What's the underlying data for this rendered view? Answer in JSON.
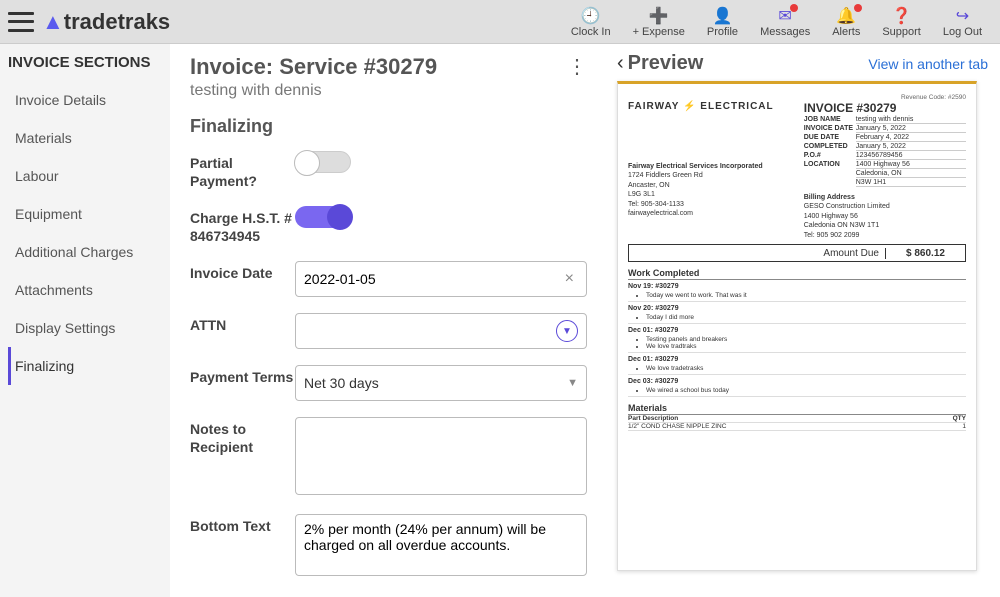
{
  "brand": {
    "name": "tradetraks"
  },
  "top_actions": [
    {
      "label": "Clock In",
      "icon": "🕘",
      "name": "clock-in"
    },
    {
      "label": "+ Expense",
      "icon": "➕",
      "name": "add-expense"
    },
    {
      "label": "Profile",
      "icon": "👤",
      "name": "profile"
    },
    {
      "label": "Messages",
      "icon": "✉",
      "name": "messages",
      "badge": true
    },
    {
      "label": "Alerts",
      "icon": "🔔",
      "name": "alerts",
      "badge": true
    },
    {
      "label": "Support",
      "icon": "❓",
      "name": "support"
    },
    {
      "label": "Log Out",
      "icon": "↪",
      "name": "logout"
    }
  ],
  "sidebar": {
    "heading": "INVOICE SECTIONS",
    "items": [
      "Invoice Details",
      "Materials",
      "Labour",
      "Equipment",
      "Additional Charges",
      "Attachments",
      "Display Settings",
      "Finalizing"
    ],
    "active_index": 7
  },
  "form": {
    "title": "Invoice: Service #30279",
    "subtitle": "testing with dennis",
    "section_heading": "Finalizing",
    "labels": {
      "partial_payment": "Partial Payment?",
      "charge_hst": "Charge H.S.T. # 846734945",
      "invoice_date": "Invoice Date",
      "attn": "ATTN",
      "payment_terms": "Payment Terms",
      "notes": "Notes to Recipient",
      "bottom_text": "Bottom Text"
    },
    "values": {
      "partial_payment": false,
      "charge_hst": true,
      "invoice_date": "2022-01-05",
      "attn": "",
      "payment_terms": "Net 30 days",
      "notes": "",
      "bottom_text": "2% per month (24% per annum) will be charged on all overdue accounts."
    }
  },
  "preview": {
    "title": "Preview",
    "new_tab": "View in another tab"
  },
  "invoice_doc": {
    "revenue_code": "Revenue Code: #2590",
    "company_logo": "FAIRWAY ⚡ ELECTRICAL",
    "heading": "INVOICE #30279",
    "meta": [
      {
        "k": "JOB NAME",
        "v": "testing with dennis"
      },
      {
        "k": "INVOICE DATE",
        "v": "January 5, 2022"
      },
      {
        "k": "DUE DATE",
        "v": "February 4, 2022"
      },
      {
        "k": "COMPLETED",
        "v": "January 5, 2022"
      },
      {
        "k": "P.O.#",
        "v": "123456789456"
      },
      {
        "k": "LOCATION",
        "v": "1400 Highway 56"
      },
      {
        "k": "",
        "v": "Caledonia, ON"
      },
      {
        "k": "",
        "v": "N3W 1H1"
      }
    ],
    "company_addr": [
      "Fairway Electrical Services Incorporated",
      "1724 Fiddlers Green Rd",
      "Ancaster, ON",
      "L9G 3L1",
      "Tel: 905-304-1133",
      "fairwayelectrical.com"
    ],
    "billing": {
      "heading": "Billing Address",
      "lines": [
        "GESO Construction Limited",
        "1400 Highway 56",
        "Caledonia ON N3W 1T1",
        "Tel: 905 902 2099"
      ]
    },
    "amount_due": {
      "label": "Amount Due",
      "value": "$ 860.12"
    },
    "work_completed": {
      "heading": "Work Completed",
      "entries": [
        {
          "date": "Nov 19: #30279",
          "notes": [
            "Today we went to work. That was it"
          ]
        },
        {
          "date": "Nov 20: #30279",
          "notes": [
            "Today I did more"
          ]
        },
        {
          "date": "Dec 01: #30279",
          "notes": [
            "Testing panels and breakers",
            "We love tradtraks"
          ]
        },
        {
          "date": "Dec 01: #30279",
          "notes": [
            "We love tradetrasks"
          ]
        },
        {
          "date": "Dec 03: #30279",
          "notes": [
            "We wired a school bus today"
          ]
        }
      ]
    },
    "materials": {
      "heading": "Materials",
      "header": {
        "desc": "Part Description",
        "qty": "QTY"
      },
      "rows": [
        {
          "desc": "1/2\" COND CHASE NIPPLE ZINC",
          "qty": "1"
        }
      ]
    }
  }
}
